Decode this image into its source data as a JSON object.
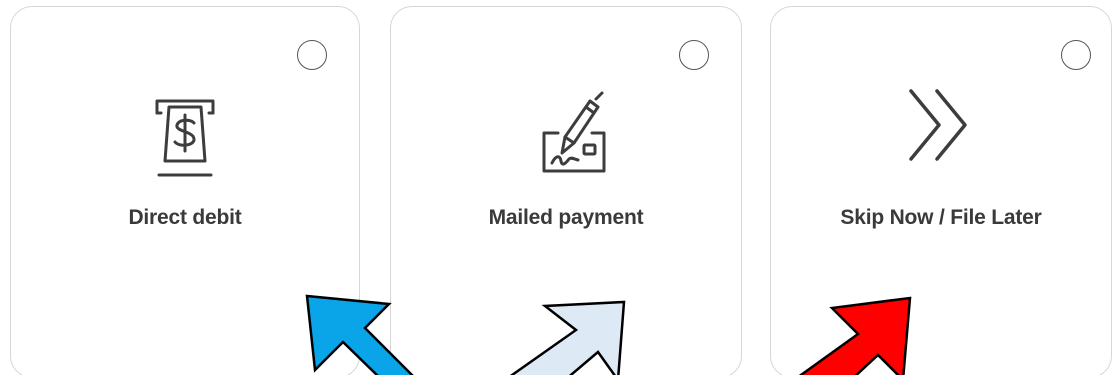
{
  "options": [
    {
      "label": "Direct debit",
      "icon": "atm-cash-icon",
      "selected": false
    },
    {
      "label": "Mailed payment",
      "icon": "check-signing-icon",
      "selected": false
    },
    {
      "label": "Skip Now / File Later",
      "icon": "double-chevron-right-icon",
      "selected": false
    }
  ],
  "annotation_arrows": [
    {
      "name": "blue-arrow",
      "color": "#0aa4e8",
      "direction": "up-left"
    },
    {
      "name": "light-blue-arrow",
      "color": "#dde9f4",
      "direction": "up-right"
    },
    {
      "name": "red-arrow",
      "color": "#ff0000",
      "direction": "up-right"
    }
  ],
  "colors": {
    "card_border": "#d6d6d6",
    "label_text": "#3a3a3a",
    "icon_stroke": "#3d3d3d",
    "radio_border": "#555555"
  }
}
